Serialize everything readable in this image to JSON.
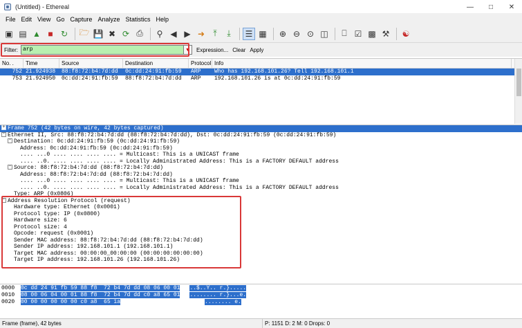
{
  "window": {
    "title": "(Untitled) - Ethereal"
  },
  "menu": [
    "File",
    "Edit",
    "View",
    "Go",
    "Capture",
    "Analyze",
    "Statistics",
    "Help"
  ],
  "filter": {
    "label": "Filter:",
    "value": "arp",
    "expression": "Expression...",
    "clear": "Clear",
    "apply": "Apply"
  },
  "packet_list": {
    "columns": [
      "No. .",
      "Time",
      "Source",
      "Destination",
      "Protocol",
      "Info"
    ],
    "rows": [
      {
        "no": "752",
        "time": "21.924938",
        "source": "88:f8:72:b4:7d:dd",
        "destination": "0c:dd:24:91:fb:59",
        "protocol": "ARP",
        "info": "Who has 192.168.101.26?  Tell 192.168.101.1"
      },
      {
        "no": "753",
        "time": "21.924950",
        "source": "0c:dd:24:91:fb:59",
        "destination": "88:f8:72:b4:7d:dd",
        "protocol": "ARP",
        "info": "192.168.101.26 is at 0c:dd:24:91:fb:59"
      }
    ]
  },
  "details": [
    {
      "indent": 0,
      "toggle": "+",
      "text": "Frame 752 (42 bytes on wire, 42 bytes captured)"
    },
    {
      "indent": 0,
      "toggle": "-",
      "text": "Ethernet II, Src: 88:f8:72:b4:7d:dd (88:f8:72:b4:7d:dd), Dst: 0c:dd:24:91:fb:59 (0c:dd:24:91:fb:59)"
    },
    {
      "indent": 1,
      "toggle": "-",
      "text": "Destination: 0c:dd:24:91:fb:59 (0c:dd:24:91:fb:59)"
    },
    {
      "indent": 2,
      "toggle": "",
      "text": "Address: 0c:dd:24:91:fb:59 (0c:dd:24:91:fb:59)"
    },
    {
      "indent": 2,
      "toggle": "",
      "text": ".... ...0 .... .... .... .... = Multicast: This is a UNICAST frame"
    },
    {
      "indent": 2,
      "toggle": "",
      "text": ".... ..0. .... .... .... .... = Locally Administrated Address: This is a FACTORY DEFAULT address"
    },
    {
      "indent": 1,
      "toggle": "-",
      "text": "Source: 88:f8:72:b4:7d:dd (88:f8:72:b4:7d:dd)"
    },
    {
      "indent": 2,
      "toggle": "",
      "text": "Address: 88:f8:72:b4:7d:dd (88:f8:72:b4:7d:dd)"
    },
    {
      "indent": 2,
      "toggle": "",
      "text": ".... ...0 .... .... .... .... = Multicast: This is a UNICAST frame"
    },
    {
      "indent": 2,
      "toggle": "",
      "text": ".... ..0. .... .... .... .... = Locally Administrated Address: This is a FACTORY DEFAULT address"
    },
    {
      "indent": 1,
      "toggle": "",
      "text": "Type: ARP (0x0806)"
    },
    {
      "indent": 0,
      "toggle": "-",
      "text": "Address Resolution Protocol (request)"
    },
    {
      "indent": 1,
      "toggle": "",
      "text": "Hardware type: Ethernet (0x0001)"
    },
    {
      "indent": 1,
      "toggle": "",
      "text": "Protocol type: IP (0x0800)"
    },
    {
      "indent": 1,
      "toggle": "",
      "text": "Hardware size: 6"
    },
    {
      "indent": 1,
      "toggle": "",
      "text": "Protocol size: 4"
    },
    {
      "indent": 1,
      "toggle": "",
      "text": "Opcode: request (0x0001)"
    },
    {
      "indent": 1,
      "toggle": "",
      "text": "Sender MAC address: 88:f8:72:b4:7d:dd (88:f8:72:b4:7d:dd)"
    },
    {
      "indent": 1,
      "toggle": "",
      "text": "Sender IP address: 192.168.101.1 (192.168.101.1)"
    },
    {
      "indent": 1,
      "toggle": "",
      "text": "Target MAC address: 00:00:00_00:00:00 (00:00:00:00:00:00)"
    },
    {
      "indent": 1,
      "toggle": "",
      "text": "Target IP address: 192.168.101.26 (192.168.101.26)"
    }
  ],
  "hex": [
    {
      "offset": "0000",
      "bytes": "0c dd 24 91 fb 59 88 f8  72 b4 7d dd 08 06 00 01",
      "ascii": "..$..Y.. r.}....."
    },
    {
      "offset": "0010",
      "bytes": "08 00 06 04 00 01 88 f8  72 b4 7d dd c0 a8 65 01",
      "ascii": "........ r.}...e."
    },
    {
      "offset": "0020",
      "bytes": "00 00 00 00 00 00 c0 a8  65 1a",
      "ascii": "........ e."
    }
  ],
  "status": {
    "left": "Frame (frame), 42 bytes",
    "right": "P: 1151 D: 2 M: 0 Drops: 0"
  },
  "colors": {
    "selection": "#2d6fcc",
    "filter_ok": "#b8f0b0",
    "highlight": "#d93838"
  }
}
